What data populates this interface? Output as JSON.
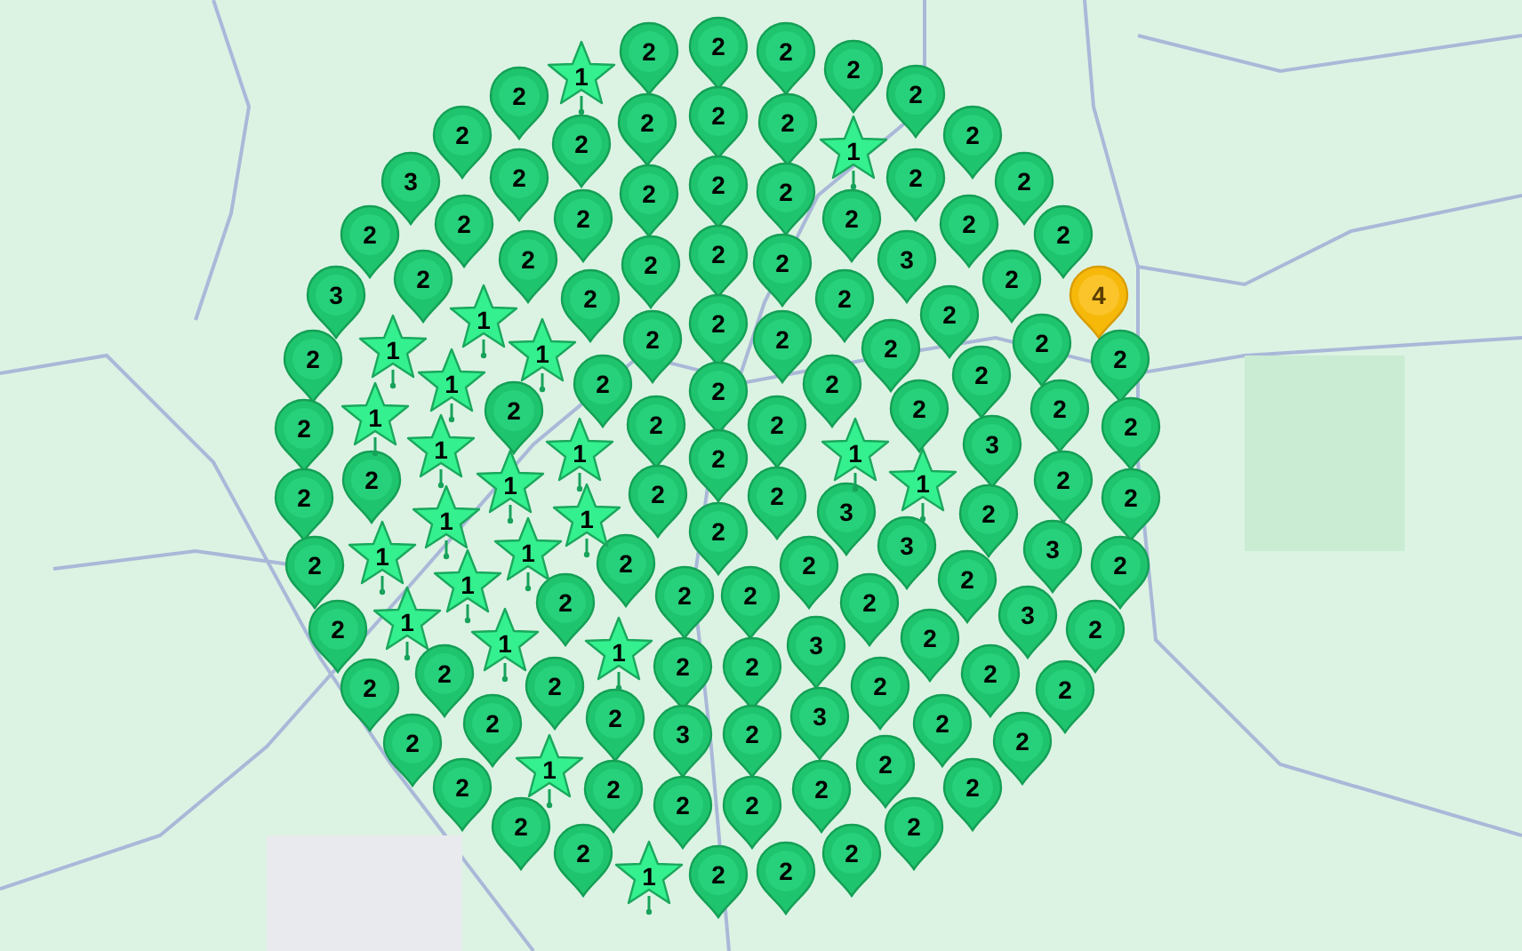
{
  "markers": [
    {
      "kind": "pin",
      "label": "2"
    },
    {
      "kind": "pin",
      "label": "2"
    },
    {
      "kind": "pin",
      "label": "2"
    },
    {
      "kind": "pin",
      "label": "2"
    },
    {
      "kind": "star",
      "label": "1"
    },
    {
      "kind": "pin",
      "label": "2"
    },
    {
      "kind": "pin",
      "label": "2"
    },
    {
      "kind": "pin",
      "label": "2"
    },
    {
      "kind": "pin",
      "label": "2"
    },
    {
      "kind": "pin",
      "label": "2"
    },
    {
      "kind": "pin",
      "label": "2"
    },
    {
      "kind": "pin",
      "label": "2"
    },
    {
      "kind": "star",
      "label": "1"
    },
    {
      "kind": "pin",
      "label": "2"
    },
    {
      "kind": "pin",
      "label": "3"
    },
    {
      "kind": "pin",
      "label": "2"
    },
    {
      "kind": "pin",
      "label": "2"
    },
    {
      "kind": "pin",
      "label": "2"
    },
    {
      "kind": "pin",
      "label": "2"
    },
    {
      "kind": "pin",
      "label": "2"
    },
    {
      "kind": "pin",
      "label": "2"
    },
    {
      "kind": "pin",
      "label": "2"
    },
    {
      "kind": "pin",
      "label": "2"
    },
    {
      "kind": "pin",
      "label": "2"
    },
    {
      "kind": "pin",
      "label": "2"
    },
    {
      "kind": "pin",
      "label": "2"
    },
    {
      "kind": "pin",
      "label": "2"
    },
    {
      "kind": "pin",
      "label": "2"
    },
    {
      "kind": "pin",
      "label": "2"
    },
    {
      "kind": "pin",
      "label": "2"
    },
    {
      "kind": "pin",
      "label": "2"
    },
    {
      "kind": "pin",
      "label": "2"
    },
    {
      "kind": "pin",
      "label": "3"
    },
    {
      "kind": "pin",
      "label": "2"
    },
    {
      "kind": "pin",
      "label": "3"
    },
    {
      "kind": "star",
      "label": "1"
    },
    {
      "kind": "pin",
      "label": "2"
    },
    {
      "kind": "pin",
      "label": "2"
    },
    {
      "kind": "pin",
      "label": "2"
    },
    {
      "kind": "cluster",
      "label": "4"
    },
    {
      "kind": "pin",
      "label": "2"
    },
    {
      "kind": "star",
      "label": "1"
    },
    {
      "kind": "star",
      "label": "1"
    },
    {
      "kind": "pin",
      "label": "2"
    },
    {
      "kind": "pin",
      "label": "2"
    },
    {
      "kind": "pin",
      "label": "2"
    },
    {
      "kind": "pin",
      "label": "2"
    },
    {
      "kind": "pin",
      "label": "2"
    },
    {
      "kind": "pin",
      "label": "2"
    },
    {
      "kind": "star",
      "label": "1"
    },
    {
      "kind": "pin",
      "label": "2"
    },
    {
      "kind": "pin",
      "label": "2"
    },
    {
      "kind": "pin",
      "label": "2"
    },
    {
      "kind": "pin",
      "label": "2"
    },
    {
      "kind": "pin",
      "label": "2"
    },
    {
      "kind": "star",
      "label": "1"
    },
    {
      "kind": "pin",
      "label": "2"
    },
    {
      "kind": "pin",
      "label": "2"
    },
    {
      "kind": "pin",
      "label": "2"
    },
    {
      "kind": "pin",
      "label": "2"
    },
    {
      "kind": "pin",
      "label": "2"
    },
    {
      "kind": "pin",
      "label": "2"
    },
    {
      "kind": "star",
      "label": "1"
    },
    {
      "kind": "star",
      "label": "1"
    },
    {
      "kind": "pin",
      "label": "2"
    },
    {
      "kind": "star",
      "label": "1"
    },
    {
      "kind": "pin",
      "label": "3"
    },
    {
      "kind": "pin",
      "label": "2"
    },
    {
      "kind": "pin",
      "label": "2"
    },
    {
      "kind": "star",
      "label": "1"
    },
    {
      "kind": "pin",
      "label": "2"
    },
    {
      "kind": "pin",
      "label": "2"
    },
    {
      "kind": "star",
      "label": "1"
    },
    {
      "kind": "pin",
      "label": "2"
    },
    {
      "kind": "pin",
      "label": "2"
    },
    {
      "kind": "star",
      "label": "1"
    },
    {
      "kind": "star",
      "label": "1"
    },
    {
      "kind": "pin",
      "label": "2"
    },
    {
      "kind": "pin",
      "label": "3"
    },
    {
      "kind": "pin",
      "label": "2"
    },
    {
      "kind": "pin",
      "label": "2"
    },
    {
      "kind": "star",
      "label": "1"
    },
    {
      "kind": "star",
      "label": "1"
    },
    {
      "kind": "pin",
      "label": "2"
    },
    {
      "kind": "pin",
      "label": "2"
    },
    {
      "kind": "pin",
      "label": "3"
    },
    {
      "kind": "pin",
      "label": "3"
    },
    {
      "kind": "pin",
      "label": "2"
    },
    {
      "kind": "star",
      "label": "1"
    },
    {
      "kind": "pin",
      "label": "2"
    },
    {
      "kind": "pin",
      "label": "2"
    },
    {
      "kind": "pin",
      "label": "2"
    },
    {
      "kind": "pin",
      "label": "2"
    },
    {
      "kind": "pin",
      "label": "2"
    },
    {
      "kind": "pin",
      "label": "2"
    },
    {
      "kind": "star",
      "label": "1"
    },
    {
      "kind": "star",
      "label": "1"
    },
    {
      "kind": "star",
      "label": "1"
    },
    {
      "kind": "pin",
      "label": "3"
    },
    {
      "kind": "pin",
      "label": "2"
    },
    {
      "kind": "pin",
      "label": "3"
    },
    {
      "kind": "pin",
      "label": "2"
    },
    {
      "kind": "pin",
      "label": "2"
    },
    {
      "kind": "pin",
      "label": "2"
    },
    {
      "kind": "pin",
      "label": "2"
    },
    {
      "kind": "pin",
      "label": "2"
    },
    {
      "kind": "pin",
      "label": "2"
    },
    {
      "kind": "pin",
      "label": "2"
    },
    {
      "kind": "pin",
      "label": "2"
    },
    {
      "kind": "pin",
      "label": "2"
    },
    {
      "kind": "pin",
      "label": "2"
    },
    {
      "kind": "pin",
      "label": "2"
    },
    {
      "kind": "pin",
      "label": "2"
    },
    {
      "kind": "pin",
      "label": "3"
    },
    {
      "kind": "pin",
      "label": "2"
    },
    {
      "kind": "pin",
      "label": "3"
    },
    {
      "kind": "pin",
      "label": "2"
    },
    {
      "kind": "pin",
      "label": "2"
    },
    {
      "kind": "star",
      "label": "1"
    },
    {
      "kind": "pin",
      "label": "2"
    },
    {
      "kind": "pin",
      "label": "2"
    },
    {
      "kind": "pin",
      "label": "2"
    },
    {
      "kind": "pin",
      "label": "2"
    },
    {
      "kind": "pin",
      "label": "2"
    },
    {
      "kind": "pin",
      "label": "2"
    },
    {
      "kind": "pin",
      "label": "2"
    },
    {
      "kind": "pin",
      "label": "2"
    },
    {
      "kind": "pin",
      "label": "2"
    },
    {
      "kind": "pin",
      "label": "2"
    },
    {
      "kind": "pin",
      "label": "2"
    },
    {
      "kind": "star",
      "label": "1"
    },
    {
      "kind": "pin",
      "label": "2"
    },
    {
      "kind": "pin",
      "label": "2"
    }
  ]
}
